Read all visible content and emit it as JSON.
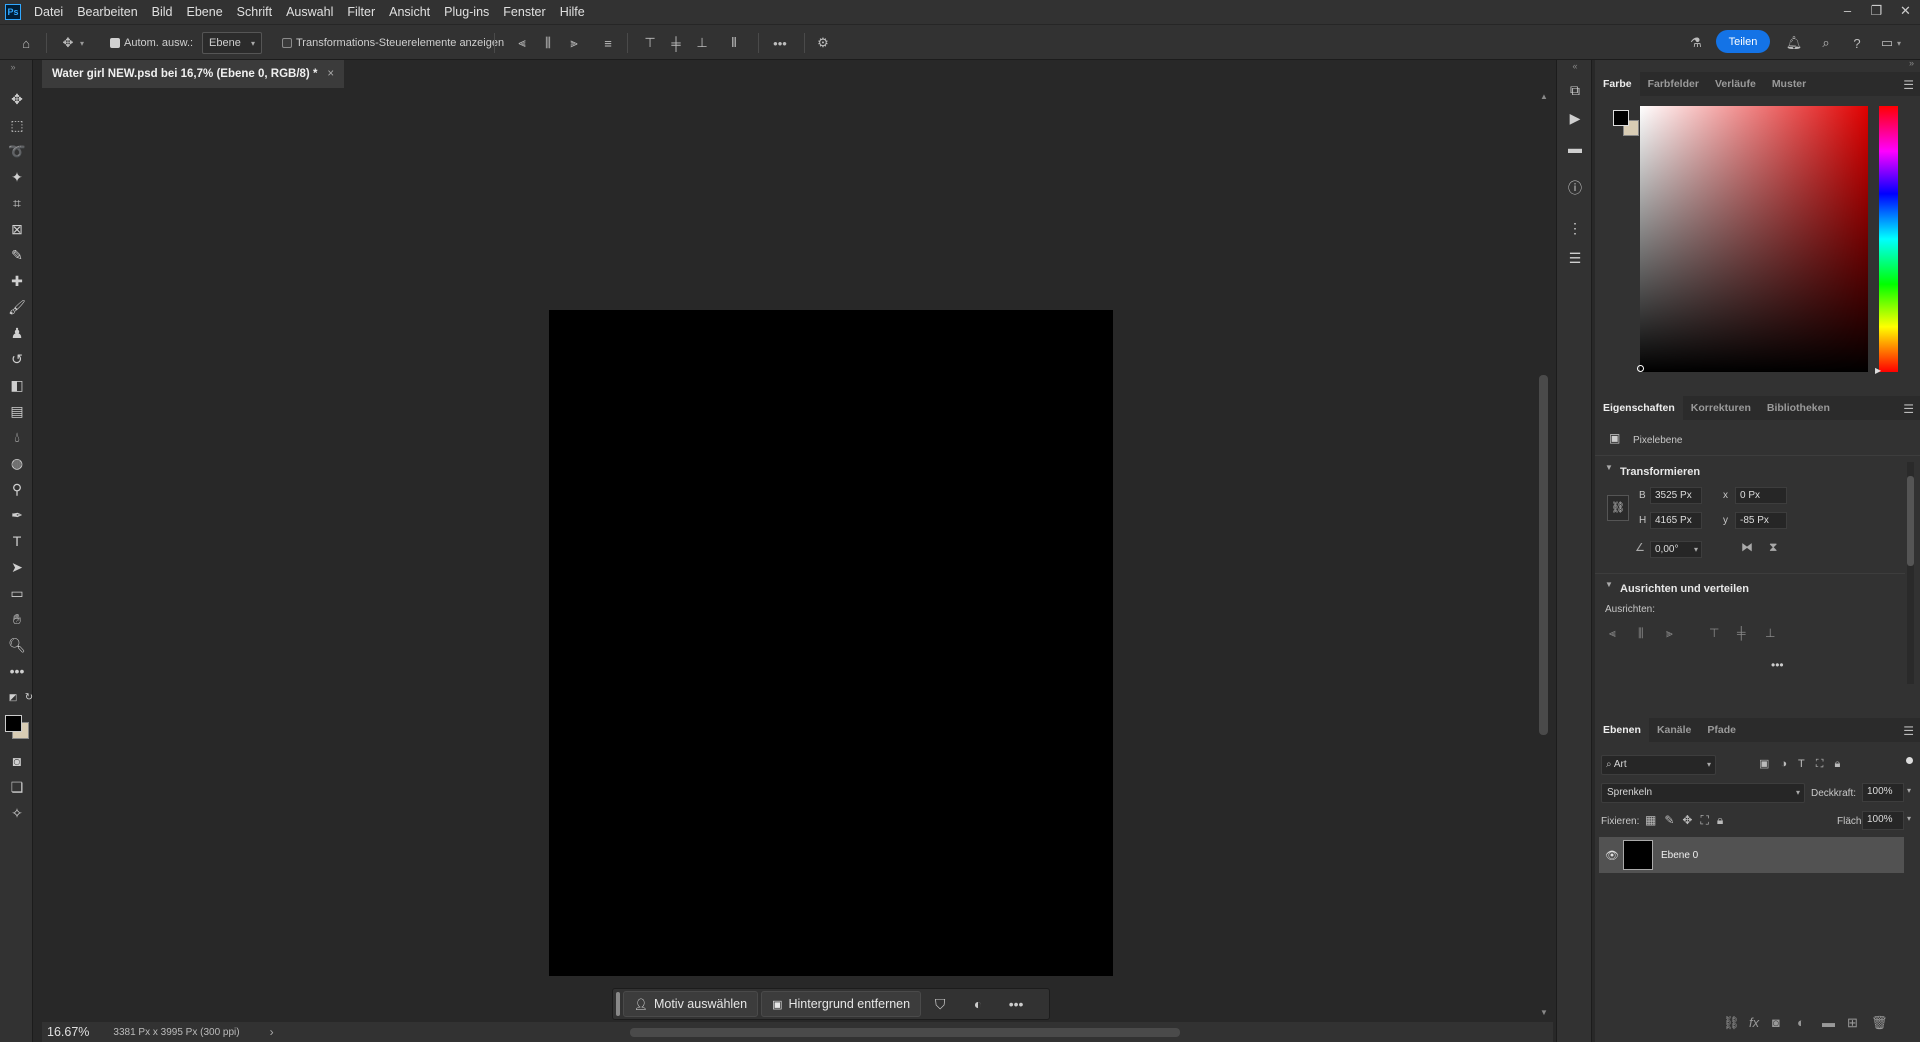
{
  "menubar": {
    "logo": "Ps",
    "items": [
      "Datei",
      "Bearbeiten",
      "Bild",
      "Ebene",
      "Schrift",
      "Auswahl",
      "Filter",
      "Ansicht",
      "Plug-ins",
      "Fenster",
      "Hilfe"
    ]
  },
  "options": {
    "auto_select_label": "Autom. ausw.:",
    "auto_select_value": "Ebene",
    "transform_controls_label": "Transformations-Steuerelemente anzeigen",
    "share_label": "Teilen"
  },
  "document": {
    "tab_title": "Water girl NEW.psd bei 16,7% (Ebene 0, RGB/8) *",
    "close": "×"
  },
  "context_bar": {
    "select_subject": "Motiv auswählen",
    "remove_background": "Hintergrund entfernen"
  },
  "status": {
    "zoom": "16.67%",
    "dimensions": "3381 Px x 3995 Px (300 ppi)"
  },
  "color_panel": {
    "tabs": [
      "Farbe",
      "Farbfelder",
      "Verläufe",
      "Muster"
    ],
    "foreground": "#000000",
    "background": "#d8ccb4"
  },
  "properties_panel": {
    "tabs": [
      "Eigenschaften",
      "Korrekturen",
      "Bibliotheken"
    ],
    "kind": "Pixelebene",
    "transform_title": "Transformieren",
    "w_label": "B",
    "w_value": "3525 Px",
    "x_label": "x",
    "x_value": "0 Px",
    "h_label": "H",
    "h_value": "4165 Px",
    "y_label": "y",
    "y_value": "-85 Px",
    "angle_value": "0,00°",
    "align_title": "Ausrichten und verteilen",
    "align_label": "Ausrichten:"
  },
  "layers_panel": {
    "tabs": [
      "Ebenen",
      "Kanäle",
      "Pfade"
    ],
    "filter_value": "Art",
    "blend_mode": "Sprenkeln",
    "opacity_label": "Deckkraft:",
    "opacity_value": "100%",
    "lock_label": "Fixieren:",
    "fill_label": "Fläche:",
    "fill_value": "100%",
    "layer_name": "Ebene 0"
  }
}
